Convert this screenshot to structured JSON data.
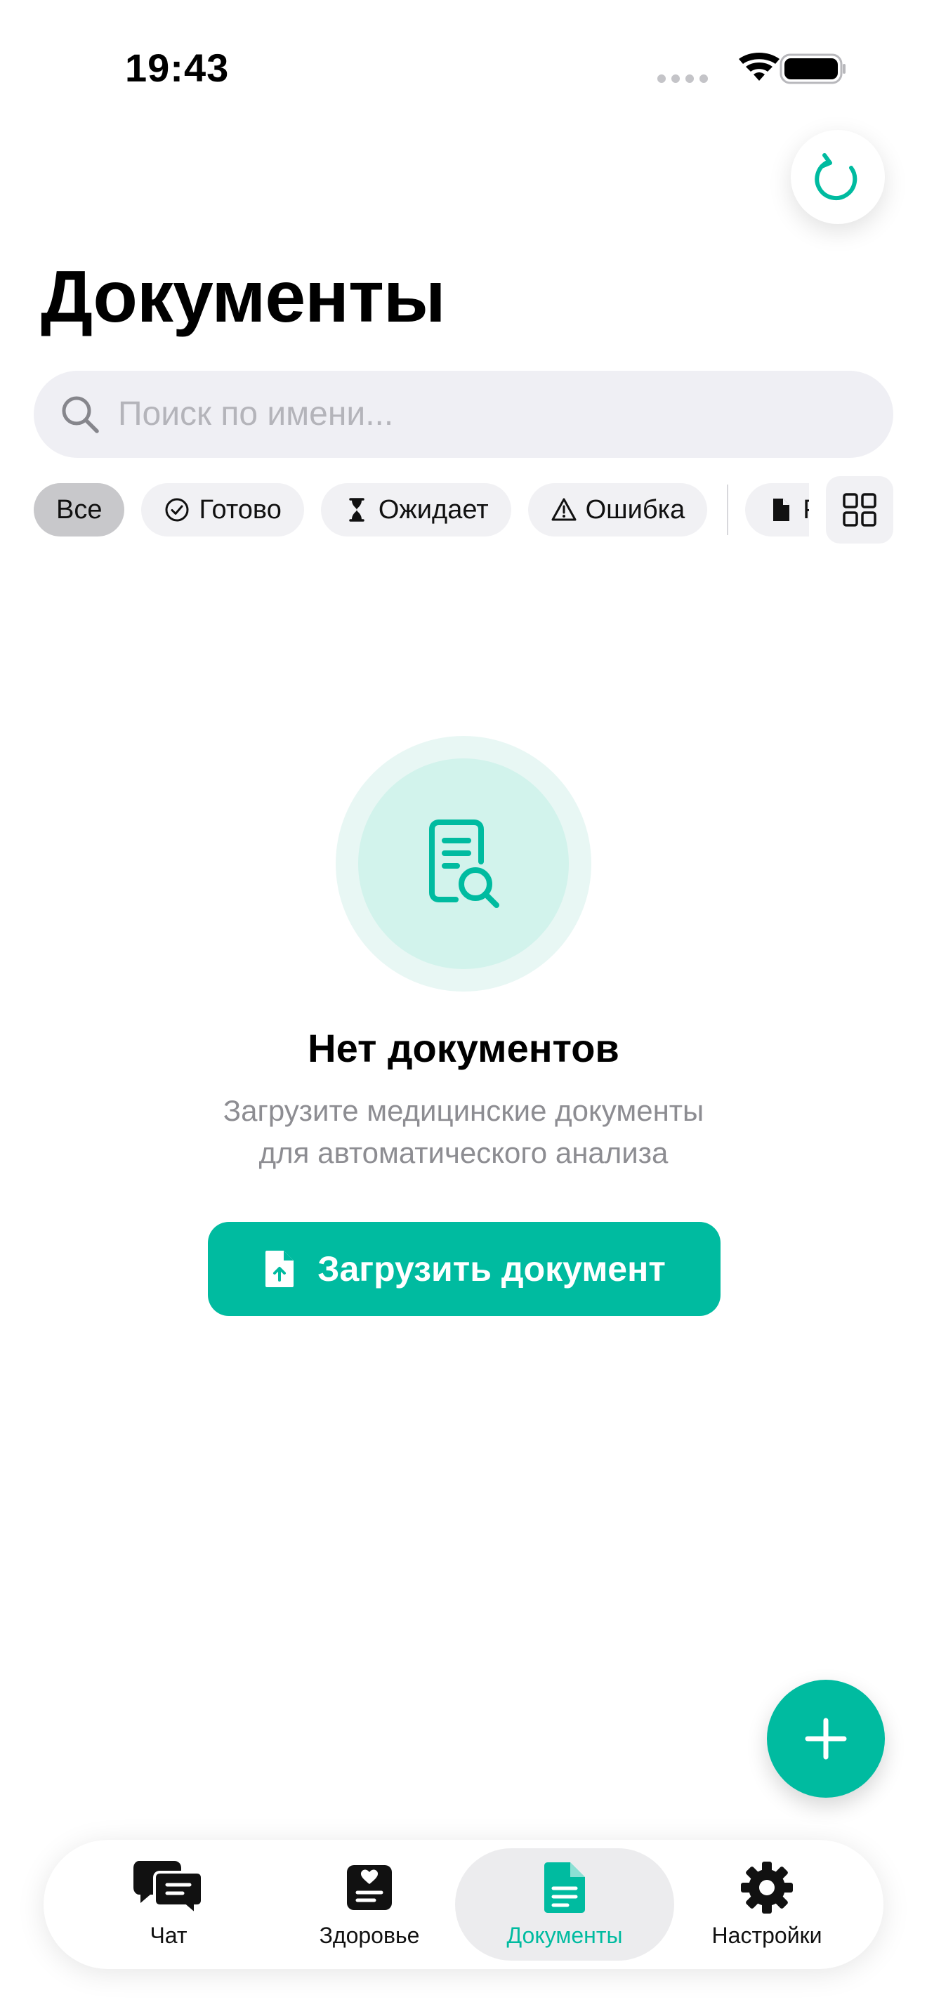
{
  "status_bar": {
    "time": "19:43"
  },
  "header": {
    "title": "Документы",
    "refresh_icon": "refresh-icon"
  },
  "search": {
    "placeholder": "Поиск по имени..."
  },
  "filters": [
    {
      "label": "Все",
      "icon": "",
      "active": true
    },
    {
      "label": "Готово",
      "icon": "check-circle-icon",
      "active": false
    },
    {
      "label": "Ожидает",
      "icon": "hourglass-icon",
      "active": false
    },
    {
      "label": "Ошибка",
      "icon": "warning-icon",
      "active": false
    },
    {
      "label": "PDF",
      "icon": "file-icon",
      "active": false
    }
  ],
  "view_toggle_icon": "grid-icon",
  "empty_state": {
    "icon": "document-search-icon",
    "title": "Нет документов",
    "subtitle_line1": "Загрузите медицинские документы",
    "subtitle_line2": "для автоматического анализа",
    "button_label": "Загрузить документ",
    "button_icon": "file-upload-icon"
  },
  "fab_icon": "plus-icon",
  "tabs": [
    {
      "label": "Чат",
      "icon": "chat-icon",
      "active": false
    },
    {
      "label": "Здоровье",
      "icon": "health-record-icon",
      "active": false
    },
    {
      "label": "Документы",
      "icon": "document-icon",
      "active": true
    },
    {
      "label": "Настройки",
      "icon": "gear-icon",
      "active": false
    }
  ],
  "colors": {
    "accent": "#00bba0",
    "accent_light": "#d2f3ec",
    "chip_bg": "#f1f1f4",
    "chip_active_bg": "#c8c8cb",
    "muted_text": "#8d8d92"
  }
}
